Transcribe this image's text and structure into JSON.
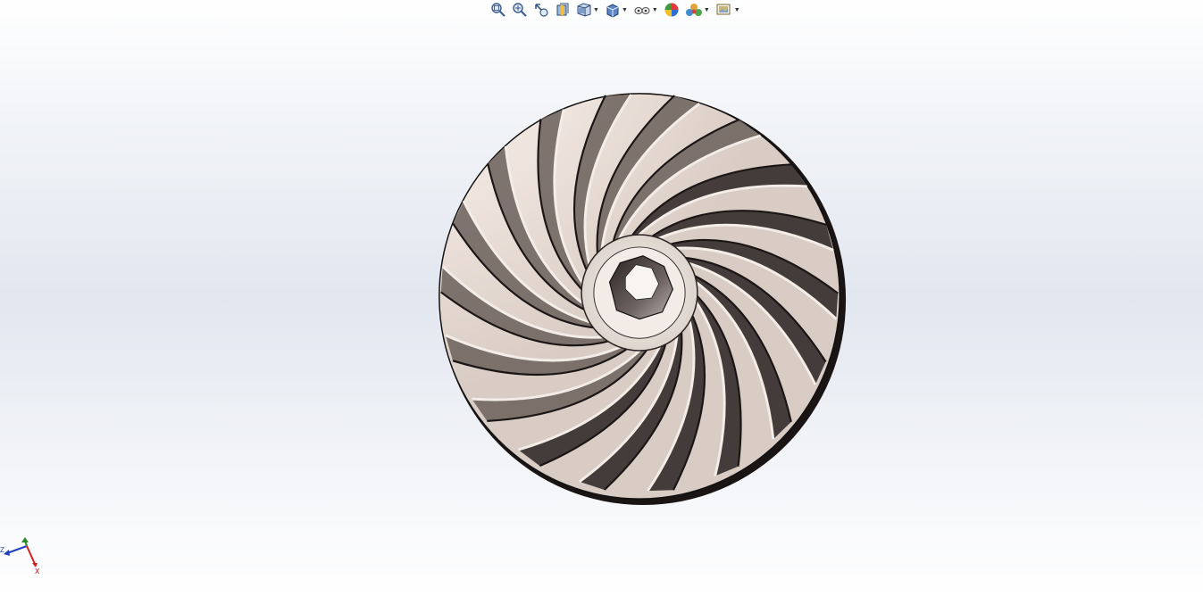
{
  "toolbar": {
    "items": [
      {
        "icon": "zoom-to-fit-icon",
        "has_dropdown": false
      },
      {
        "icon": "zoom-to-area-icon",
        "has_dropdown": false
      },
      {
        "icon": "previous-view-icon",
        "has_dropdown": false
      },
      {
        "icon": "section-view-icon",
        "has_dropdown": false
      },
      {
        "icon": "view-orientation-icon",
        "has_dropdown": true
      },
      {
        "icon": "display-style-icon",
        "has_dropdown": true
      },
      {
        "icon": "hide-show-items-icon",
        "has_dropdown": true
      },
      {
        "icon": "edit-appearance-icon",
        "has_dropdown": false
      },
      {
        "icon": "apply-scene-icon",
        "has_dropdown": true
      },
      {
        "icon": "view-settings-icon",
        "has_dropdown": true
      }
    ]
  },
  "triad": {
    "x_label": "X",
    "y_label": "",
    "z_label": "Z",
    "colors": {
      "x": "#d42020",
      "y": "#2a8a2a",
      "z": "#1f3fbf"
    }
  },
  "model": {
    "name": "impeller-3d-model",
    "blade_count": 18,
    "colors": {
      "surface": "#f3ece7",
      "shadow": "#1a1414",
      "edge": "#111111"
    }
  }
}
